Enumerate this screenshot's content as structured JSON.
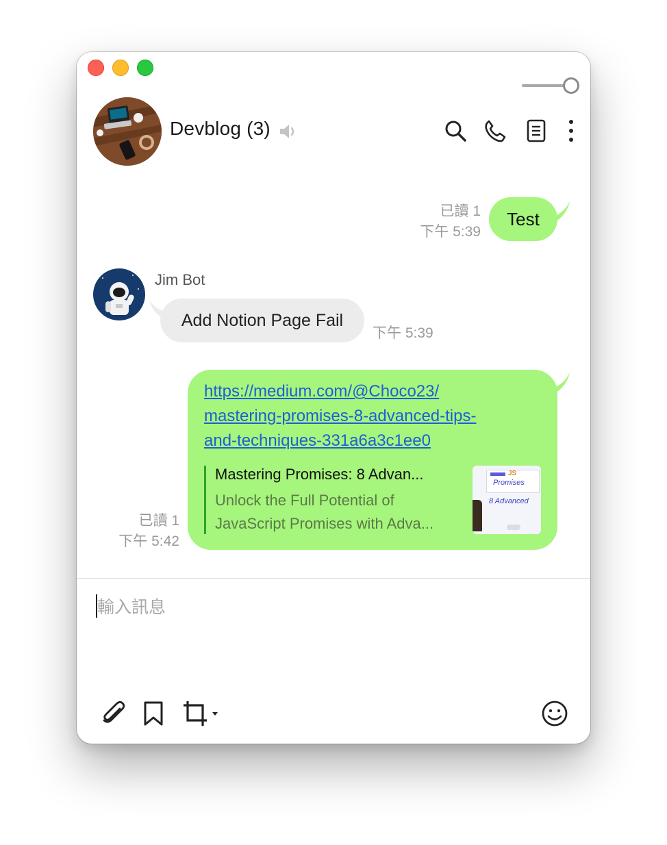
{
  "chat": {
    "name": "Devblog",
    "member_count": "(3)"
  },
  "messages": [
    {
      "type": "outgoing",
      "text": "Test",
      "read": "已讀 1",
      "time": "下午 5:39"
    },
    {
      "type": "incoming",
      "sender": "Jim Bot",
      "text": "Add Notion Page Fail",
      "time": "下午 5:39"
    },
    {
      "type": "outgoing-link",
      "link_lines": [
        "https://medium.com/@Choco23/",
        "mastering-promises-8-advanced-tips-",
        "and-techniques-331a6a3c1ee0"
      ],
      "preview_title": "Mastering Promises: 8 Advan...",
      "preview_desc_lines": [
        "Unlock the Full Potential of",
        "JavaScript Promises with Adva..."
      ],
      "thumb_text": [
        "JS",
        "Promises",
        "8 Advanced"
      ],
      "read": "已讀 1",
      "time": "下午 5:42"
    }
  ],
  "composer": {
    "placeholder": "輸入訊息"
  },
  "icons": {
    "header": [
      "search-icon",
      "phone-icon",
      "notes-icon",
      "more-icon",
      "mute-icon"
    ],
    "footer": [
      "paperclip-icon",
      "bookmark-icon",
      "crop-icon",
      "emoji-icon"
    ]
  },
  "colors": {
    "outgoing_bubble": "#a6f57c",
    "incoming_bubble": "#ececec",
    "link": "#1d5fd6",
    "preview_bar": "#2ea12e"
  }
}
